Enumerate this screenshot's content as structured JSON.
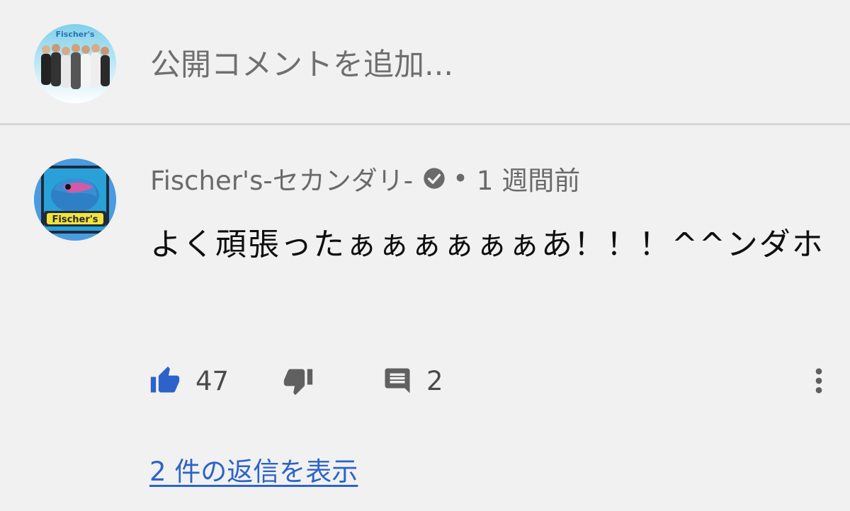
{
  "composer": {
    "placeholder": "公開コメントを追加...",
    "avatar_logo_text": "Fischer's"
  },
  "comment": {
    "author": "Fischer's-セカンダリ-",
    "verified_icon": "check-circle-icon",
    "separator": "•",
    "time": "1 週間前",
    "text": "よく頑張ったぁぁぁぁぁぁあ！！！^^ンダホ",
    "avatar_logo_text": "Fischer's",
    "likes": "47",
    "replies_count": "2",
    "view_replies_label": "2 件の返信を表示"
  },
  "colors": {
    "background": "#f1f1f1",
    "like_blue": "#2d63c8",
    "link_blue": "#2d63c8",
    "muted_text": "#6a6a6a",
    "icon_gray": "#606060"
  },
  "icons": {
    "like": "thumbs-up-icon",
    "dislike": "thumbs-down-icon",
    "reply": "comment-icon",
    "more": "more-vert-icon"
  }
}
